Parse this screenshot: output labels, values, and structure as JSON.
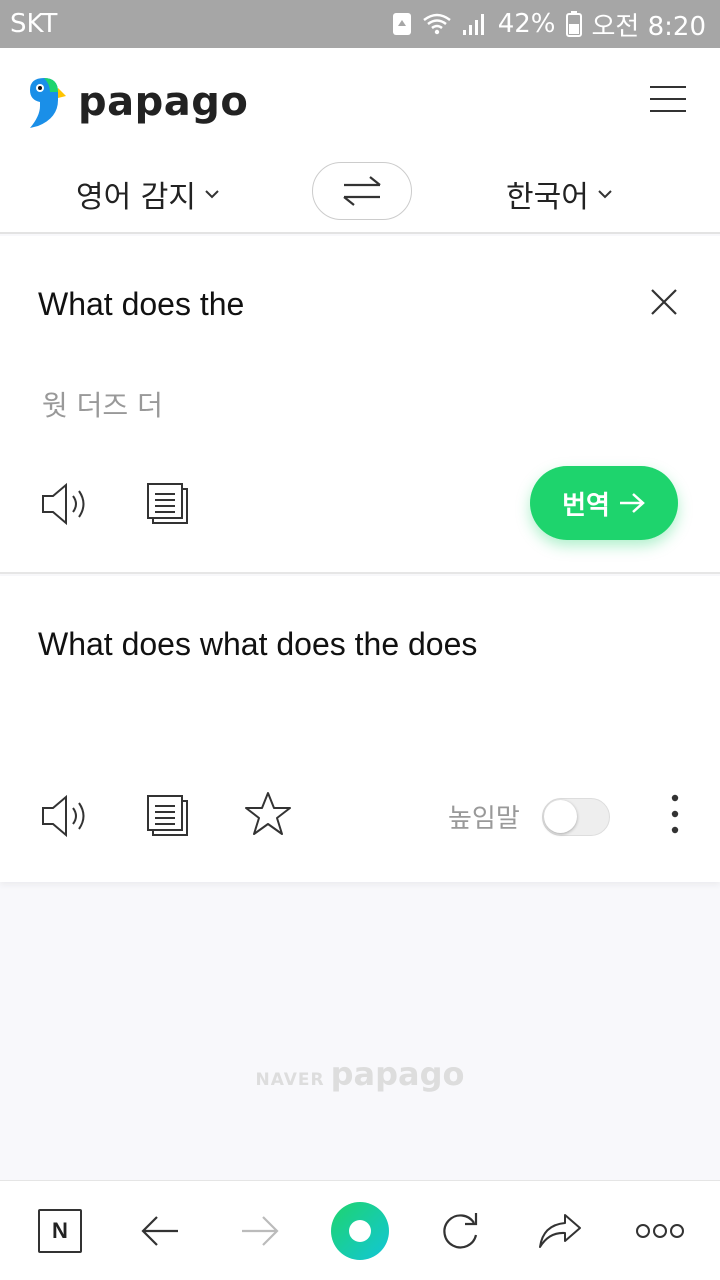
{
  "status_bar": {
    "carrier": "SKT",
    "battery": "42%",
    "time": "오전 8:20"
  },
  "header": {
    "app_name": "papago"
  },
  "languages": {
    "source": "영어 감지",
    "target": "한국어"
  },
  "input": {
    "text": "What does the",
    "pronunciation": "웟 더즈 더",
    "translate_label": "번역"
  },
  "result": {
    "text": "What does what does the does",
    "honorific_label": "높임말",
    "honorific_enabled": false
  },
  "footer": {
    "brand_naver": "NAVER",
    "brand_papago": "papago"
  },
  "bottom_nav": {
    "n_label": "N"
  },
  "colors": {
    "accent": "#1ed46d",
    "status_bar": "#a6a6a6"
  }
}
